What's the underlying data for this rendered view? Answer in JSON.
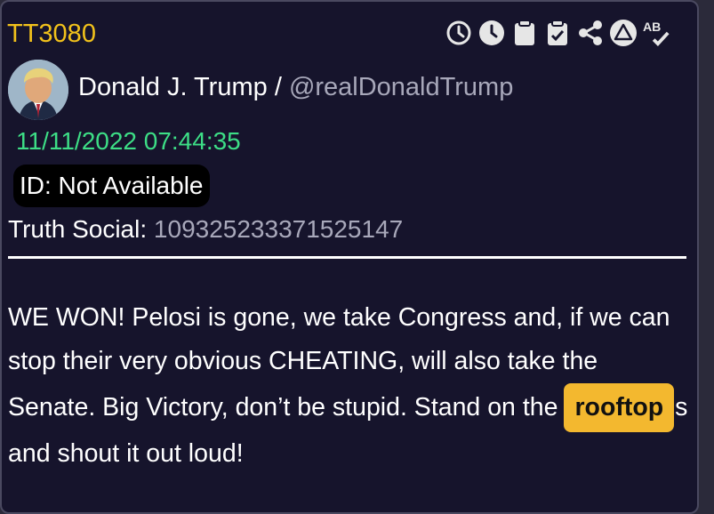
{
  "post": {
    "id_label": "TT3080",
    "author_name": "Donald J. Trump",
    "separator": " / ",
    "handle": "@realDonaldTrump",
    "timestamp": "11/11/2022 07:44:35",
    "id_badge": "ID: Not Available",
    "truth_label": "Truth Social: ",
    "truth_number": "109325233371525147",
    "body": {
      "text_before": "WE WON! Pelosi is gone, we take Congress and, if we can stop their very obvious CHEATING, will also take the Senate. Big Victory, don’t be stupid. Stand on the",
      "highlight": "rooftop",
      "text_after": "s and shout it out loud!"
    }
  },
  "toolbar": {
    "icons": [
      "history-icon",
      "clock-icon",
      "clipboard-icon",
      "clipboard-check-icon",
      "share-icon",
      "alert-triangle-icon",
      "spellcheck-icon"
    ],
    "spellcheck_text": "AB"
  },
  "colors": {
    "background": "#16142c",
    "post_id": "#f2c21b",
    "timestamp": "#3dde86",
    "muted_text": "#a8a8ba",
    "highlight": "#f3b82f"
  }
}
